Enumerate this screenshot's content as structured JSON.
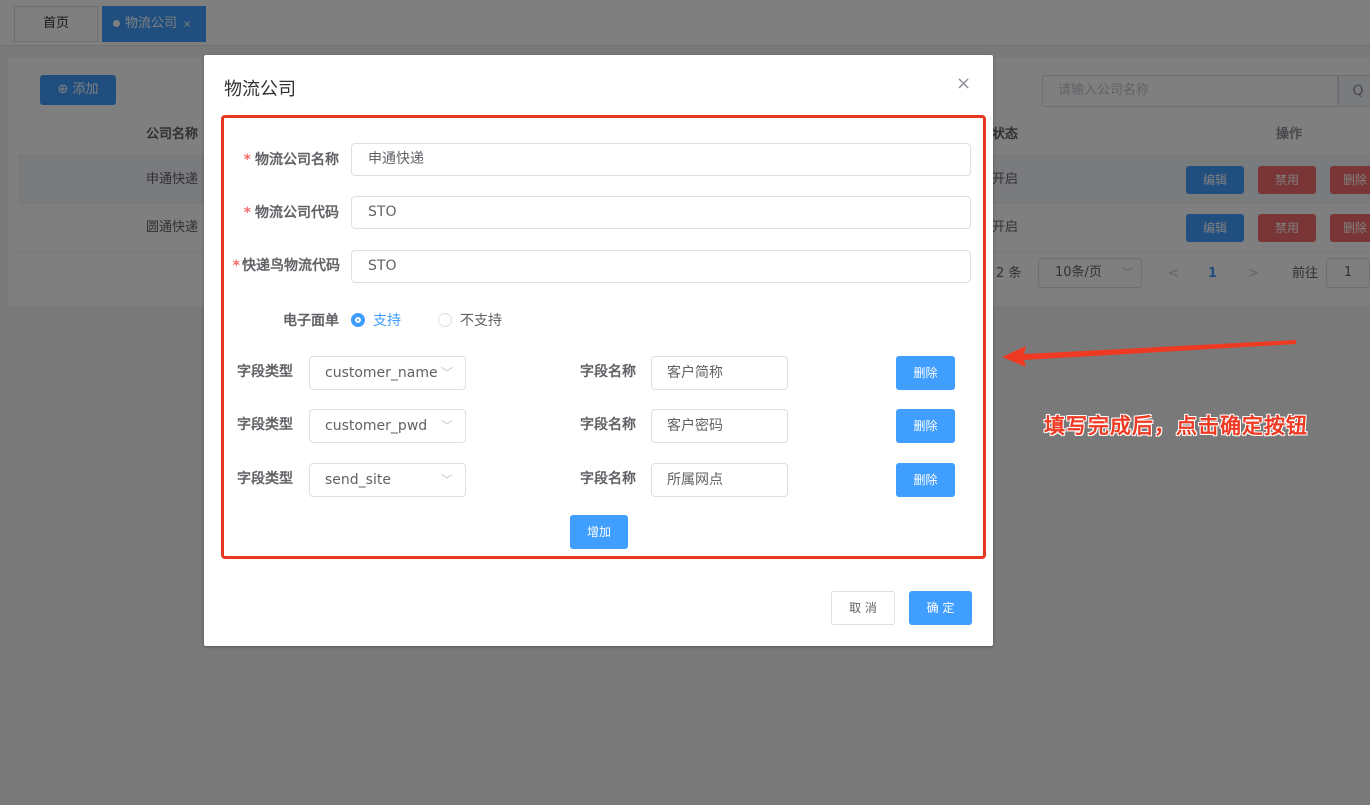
{
  "tabs": [
    {
      "label": "首页"
    },
    {
      "label": "物流公司",
      "close": "×"
    }
  ],
  "toolbar": {
    "add_icon": "⊕",
    "add_label": "添加",
    "search_placeholder": "请输入公司名称",
    "search_icon": "Q"
  },
  "table": {
    "headers": {
      "name": "公司名称",
      "status": "状态",
      "operation": "操作"
    },
    "rows": [
      {
        "name": "申通快递",
        "status": "开启",
        "edit": "编辑",
        "disable": "禁用",
        "delete": "删除"
      },
      {
        "name": "圆通快递",
        "status": "开启",
        "edit": "编辑",
        "disable": "禁用",
        "delete": "删除"
      }
    ]
  },
  "pagination": {
    "total": "2 条",
    "page_size": "10条/页",
    "prev": "<",
    "current": "1",
    "next": ">",
    "goto_label": "前往",
    "goto_value": "1"
  },
  "dialog": {
    "title": "物流公司",
    "close": "×",
    "required_mark": "*",
    "fields": {
      "company_name_label": "物流公司名称",
      "company_name_value": "申通快递",
      "company_code_label": "物流公司代码",
      "company_code_value": "STO",
      "kdniao_code_label": "快递鸟物流代码",
      "kdniao_code_value": "STO",
      "eorder_label": "电子面单",
      "eorder_support": "支持",
      "eorder_unsupport": "不支持"
    },
    "field_type_label": "字段类型",
    "field_name_label": "字段名称",
    "field_rows": [
      {
        "type": "customer_name",
        "name": "客户简称",
        "delete": "删除"
      },
      {
        "type": "customer_pwd",
        "name": "客户密码",
        "delete": "删除"
      },
      {
        "type": "send_site",
        "name": "所属网点",
        "delete": "删除"
      }
    ],
    "add_row_label": "增加",
    "cancel_label": "取 消",
    "confirm_label": "确 定"
  },
  "annotation": {
    "text": "填写完成后，点击确定按钮",
    "color": "#ee3a23"
  },
  "colors": {
    "primary": "#409eff",
    "danger": "#f56c6c"
  },
  "eorder_selected": "支持"
}
